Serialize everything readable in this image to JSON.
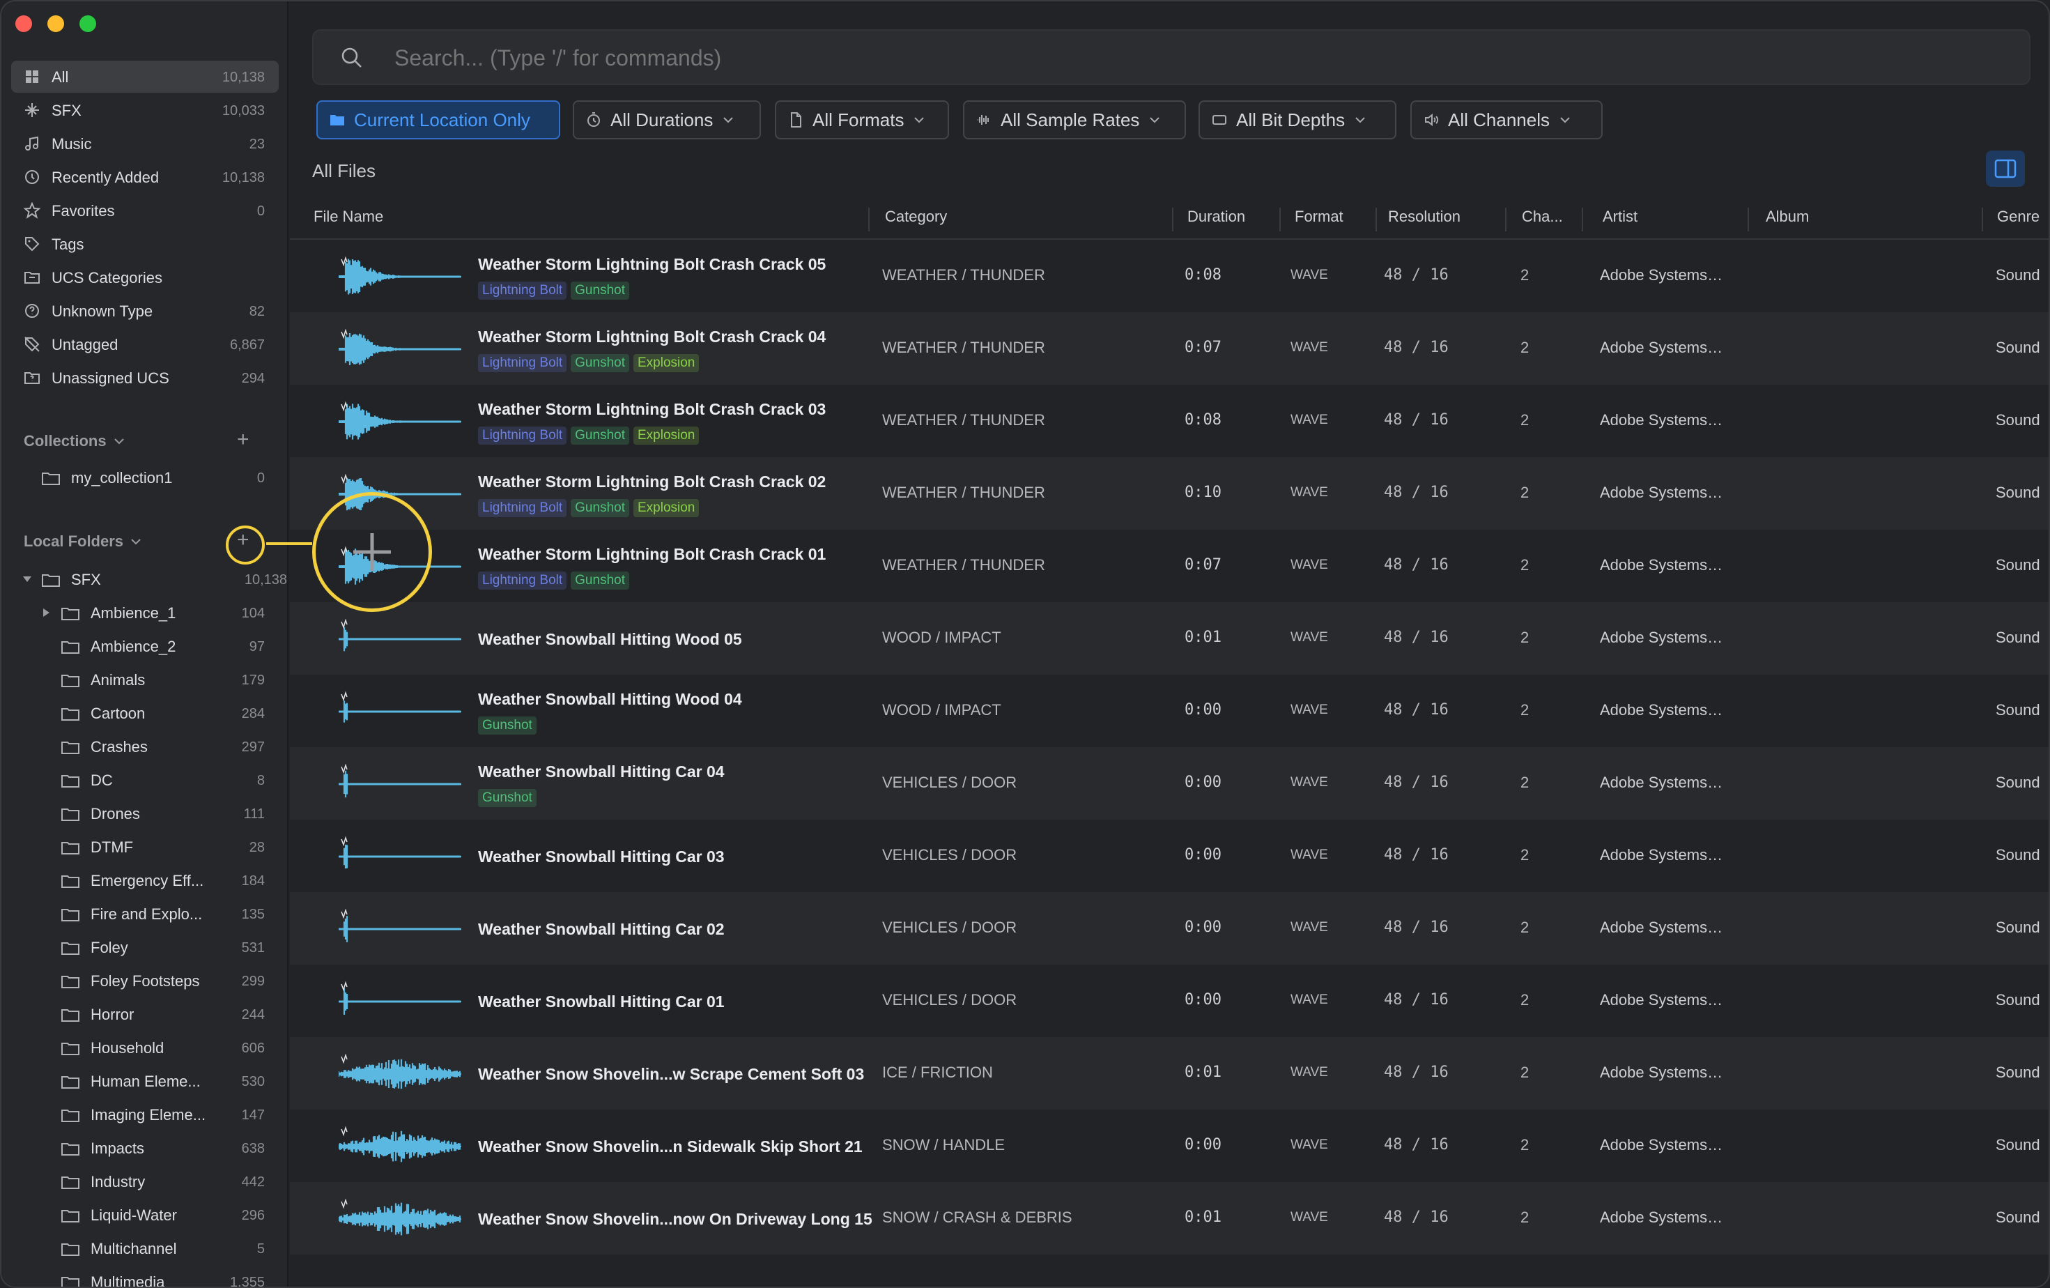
{
  "sidebar": {
    "library": [
      {
        "label": "All",
        "count": "10,138",
        "icon": "grid-icon"
      },
      {
        "label": "SFX",
        "count": "10,033",
        "icon": "sparkle-icon"
      },
      {
        "label": "Music",
        "count": "23",
        "icon": "music-note-icon"
      },
      {
        "label": "Recently Added",
        "count": "10,138",
        "icon": "clock-icon"
      },
      {
        "label": "Favorites",
        "count": "0",
        "icon": "star-icon"
      },
      {
        "label": "Tags",
        "count": "",
        "icon": "tag-icon"
      },
      {
        "label": "UCS Categories",
        "count": "",
        "icon": "folder-tree-icon"
      },
      {
        "label": "Unknown Type",
        "count": "82",
        "icon": "question-icon"
      },
      {
        "label": "Untagged",
        "count": "6,867",
        "icon": "tag-off-icon"
      },
      {
        "label": "Unassigned UCS",
        "count": "294",
        "icon": "folder-question-icon"
      }
    ],
    "collections_label": "Collections",
    "collections": [
      {
        "label": "my_collection1",
        "count": "0"
      }
    ],
    "local_folders_label": "Local Folders",
    "root_folder": {
      "label": "SFX",
      "count": "10,138"
    },
    "folders": [
      {
        "label": "Ambience_1",
        "count": "104"
      },
      {
        "label": "Ambience_2",
        "count": "97"
      },
      {
        "label": "Animals",
        "count": "179"
      },
      {
        "label": "Cartoon",
        "count": "284"
      },
      {
        "label": "Crashes",
        "count": "297"
      },
      {
        "label": "DC",
        "count": "8"
      },
      {
        "label": "Drones",
        "count": "111"
      },
      {
        "label": "DTMF",
        "count": "28"
      },
      {
        "label": "Emergency Eff...",
        "count": "184"
      },
      {
        "label": "Fire and Explo...",
        "count": "135"
      },
      {
        "label": "Foley",
        "count": "531"
      },
      {
        "label": "Foley Footsteps",
        "count": "299"
      },
      {
        "label": "Horror",
        "count": "244"
      },
      {
        "label": "Household",
        "count": "606"
      },
      {
        "label": "Human Eleme...",
        "count": "530"
      },
      {
        "label": "Imaging Eleme...",
        "count": "147"
      },
      {
        "label": "Impacts",
        "count": "638"
      },
      {
        "label": "Industry",
        "count": "442"
      },
      {
        "label": "Liquid-Water",
        "count": "296"
      },
      {
        "label": "Multichannel",
        "count": "5"
      },
      {
        "label": "Multimedia",
        "count": "1,355"
      }
    ]
  },
  "search": {
    "placeholder": "Search... (Type '/' for commands)"
  },
  "filters": [
    {
      "label": "Current Location Only",
      "icon": "folder-icon"
    },
    {
      "label": "All Durations",
      "icon": "timer-icon"
    },
    {
      "label": "All Formats",
      "icon": "file-icon"
    },
    {
      "label": "All Sample Rates",
      "icon": "waveform-icon"
    },
    {
      "label": "All Bit Depths",
      "icon": "rectangle-icon"
    },
    {
      "label": "All Channels",
      "icon": "speaker-icon"
    }
  ],
  "section_title": "All Files",
  "columns": {
    "file_name": "File Name",
    "category": "Category",
    "duration": "Duration",
    "format": "Format",
    "resolution": "Resolution",
    "channels": "Cha...",
    "artist": "Artist",
    "album": "Album",
    "genre": "Genre"
  },
  "tag_colors": {
    "Lightning Bolt": "#6b7fe0",
    "Gunshot": "#4fbf7a",
    "Explosion": "#8bd14a"
  },
  "rows": [
    {
      "name": "Weather Storm Lightning Bolt Crash Crack 05",
      "tags": [
        "Lightning Bolt",
        "Gunshot"
      ],
      "category": "WEATHER / THUNDER",
      "duration": "0:08",
      "format": "WAVE",
      "resolution": "48 / 16",
      "channels": "2",
      "artist": "Adobe Systems…",
      "genre": "Sound"
    },
    {
      "name": "Weather Storm Lightning Bolt Crash Crack 04",
      "tags": [
        "Lightning Bolt",
        "Gunshot",
        "Explosion"
      ],
      "category": "WEATHER / THUNDER",
      "duration": "0:07",
      "format": "WAVE",
      "resolution": "48 / 16",
      "channels": "2",
      "artist": "Adobe Systems…",
      "genre": "Sound"
    },
    {
      "name": "Weather Storm Lightning Bolt Crash Crack 03",
      "tags": [
        "Lightning Bolt",
        "Gunshot",
        "Explosion"
      ],
      "category": "WEATHER / THUNDER",
      "duration": "0:08",
      "format": "WAVE",
      "resolution": "48 / 16",
      "channels": "2",
      "artist": "Adobe Systems…",
      "genre": "Sound"
    },
    {
      "name": "Weather Storm Lightning Bolt Crash Crack 02",
      "tags": [
        "Lightning Bolt",
        "Gunshot",
        "Explosion"
      ],
      "category": "WEATHER / THUNDER",
      "duration": "0:10",
      "format": "WAVE",
      "resolution": "48 / 16",
      "channels": "2",
      "artist": "Adobe Systems…",
      "genre": "Sound"
    },
    {
      "name": "Weather Storm Lightning Bolt Crash Crack 01",
      "tags": [
        "Lightning Bolt",
        "Gunshot"
      ],
      "category": "WEATHER / THUNDER",
      "duration": "0:07",
      "format": "WAVE",
      "resolution": "48 / 16",
      "channels": "2",
      "artist": "Adobe Systems…",
      "genre": "Sound"
    },
    {
      "name": "Weather Snowball Hitting Wood 05",
      "tags": [],
      "category": "WOOD / IMPACT",
      "duration": "0:01",
      "format": "WAVE",
      "resolution": "48 / 16",
      "channels": "2",
      "artist": "Adobe Systems…",
      "genre": "Sound"
    },
    {
      "name": "Weather Snowball Hitting Wood 04",
      "tags": [
        "Gunshot"
      ],
      "category": "WOOD / IMPACT",
      "duration": "0:00",
      "format": "WAVE",
      "resolution": "48 / 16",
      "channels": "2",
      "artist": "Adobe Systems…",
      "genre": "Sound"
    },
    {
      "name": "Weather Snowball Hitting Car 04",
      "tags": [
        "Gunshot"
      ],
      "category": "VEHICLES / DOOR",
      "duration": "0:00",
      "format": "WAVE",
      "resolution": "48 / 16",
      "channels": "2",
      "artist": "Adobe Systems…",
      "genre": "Sound"
    },
    {
      "name": "Weather Snowball Hitting Car 03",
      "tags": [],
      "category": "VEHICLES / DOOR",
      "duration": "0:00",
      "format": "WAVE",
      "resolution": "48 / 16",
      "channels": "2",
      "artist": "Adobe Systems…",
      "genre": "Sound"
    },
    {
      "name": "Weather Snowball Hitting Car 02",
      "tags": [],
      "category": "VEHICLES / DOOR",
      "duration": "0:00",
      "format": "WAVE",
      "resolution": "48 / 16",
      "channels": "2",
      "artist": "Adobe Systems…",
      "genre": "Sound"
    },
    {
      "name": "Weather Snowball Hitting Car 01",
      "tags": [],
      "category": "VEHICLES / DOOR",
      "duration": "0:00",
      "format": "WAVE",
      "resolution": "48 / 16",
      "channels": "2",
      "artist": "Adobe Systems…",
      "genre": "Sound"
    },
    {
      "name": "Weather Snow Shovelin...w Scrape Cement Soft 03",
      "tags": [],
      "category": "ICE / FRICTION",
      "duration": "0:01",
      "format": "WAVE",
      "resolution": "48 / 16",
      "channels": "2",
      "artist": "Adobe Systems…",
      "genre": "Sound"
    },
    {
      "name": "Weather Snow Shovelin...n Sidewalk Skip Short 21",
      "tags": [],
      "category": "SNOW / HANDLE",
      "duration": "0:00",
      "format": "WAVE",
      "resolution": "48 / 16",
      "channels": "2",
      "artist": "Adobe Systems…",
      "genre": "Sound"
    },
    {
      "name": "Weather Snow Shovelin...now On Driveway Long 15",
      "tags": [],
      "category": "SNOW / CRASH & DEBRIS",
      "duration": "0:01",
      "format": "WAVE",
      "resolution": "48 / 16",
      "channels": "2",
      "artist": "Adobe Systems…",
      "genre": "Sound"
    }
  ],
  "colors": {
    "accent": "#4a9cff",
    "callout": "#f4d03f",
    "waveform": "#5bb8e0"
  }
}
